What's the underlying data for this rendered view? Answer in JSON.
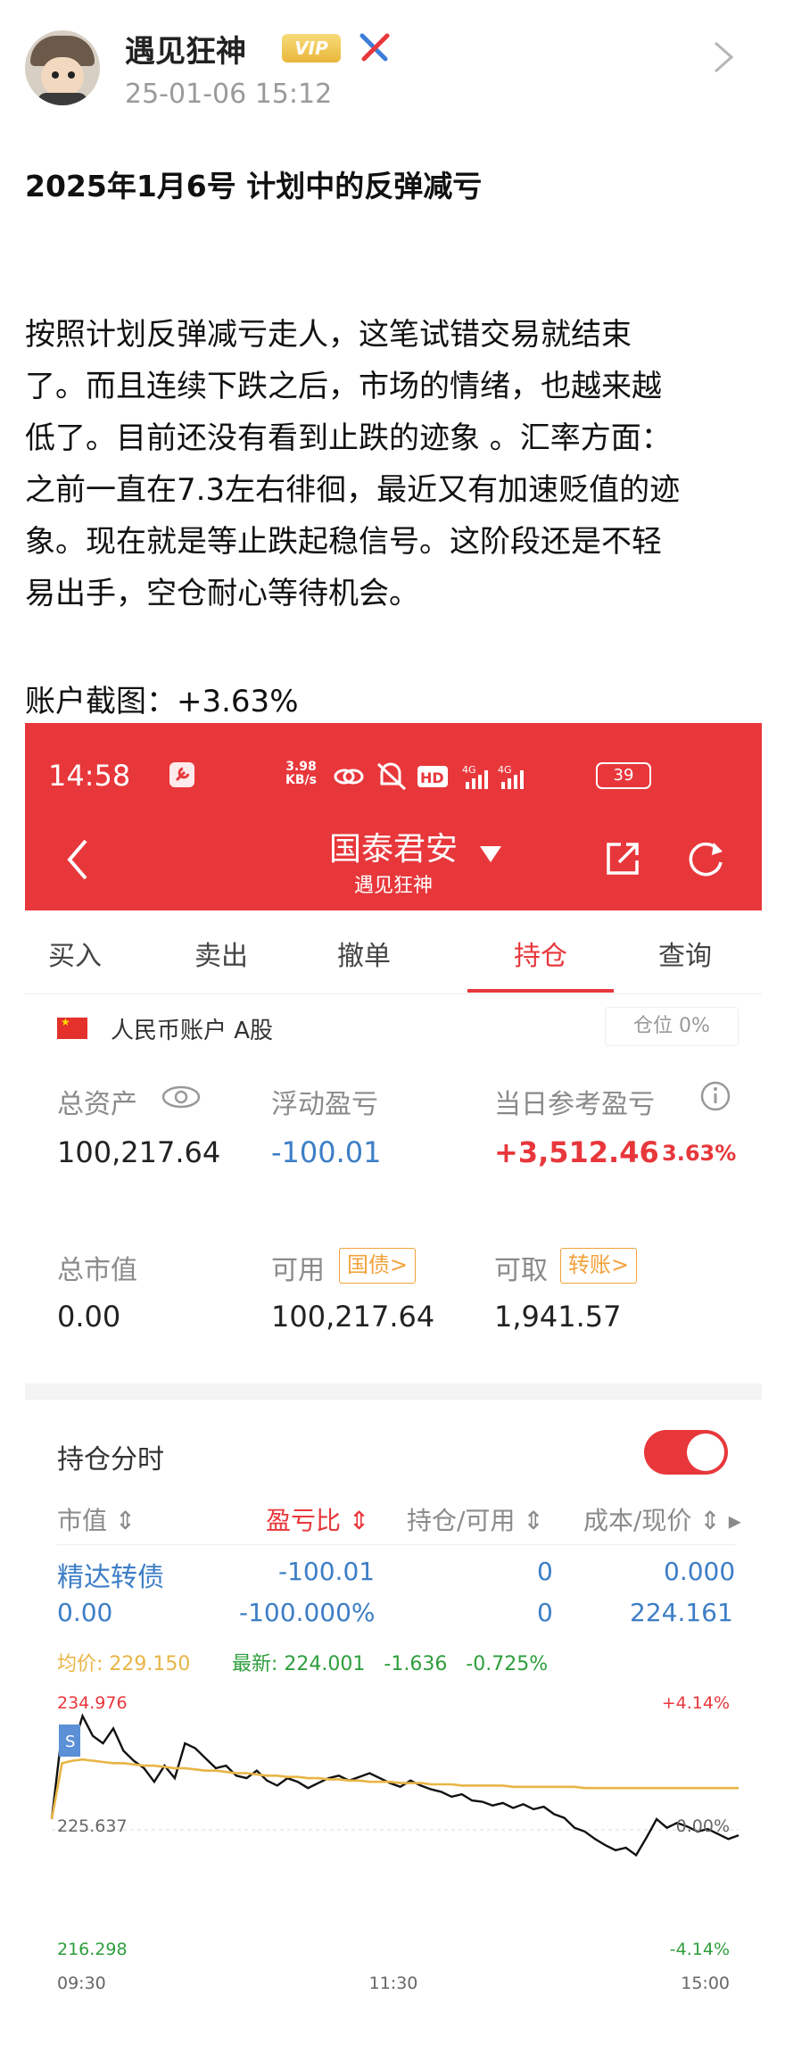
{
  "post": {
    "author": "遇见狂神",
    "vip_label": "VIP",
    "timestamp": "25-01-06 15:12",
    "title": "2025年1月6号 计划中的反弹减亏",
    "paragraph_lines": [
      "按照计划反弹减亏走人，这笔试错交易就结束",
      "了。而且连续下跌之后，市场的情绪，也越来越",
      "低了。目前还没有看到止跌的迹象 。汇率方面：",
      "之前一直在7.3左右徘徊，最近又有加速贬值的迹",
      "象。现在就是等止跌起稳信号。这阶段还是不轻",
      "易出手，空仓耐心等待机会。"
    ],
    "account_caption": "账户截图：+3.63%"
  },
  "app": {
    "status_time": "14:58",
    "net_speed_value": "3.98",
    "net_speed_unit": "KB/s",
    "battery": "39",
    "broker": "国泰君安",
    "user": "遇见狂神",
    "tabs": [
      "买入",
      "卖出",
      "撤单",
      "持仓",
      "查询"
    ],
    "active_tab": "持仓",
    "account_type": "人民币账户 A股",
    "position": "仓位 0%",
    "metrics": {
      "total_assets_label": "总资产",
      "total_assets": "100,217.64",
      "floating_pnl_label": "浮动盈亏",
      "floating_pnl": "-100.01",
      "daily_pnl_label": "当日参考盈亏",
      "daily_pnl": "+3,512.46",
      "daily_pnl_pct": "3.63%",
      "market_value_label": "总市值",
      "market_value": "0.00",
      "available_label": "可用",
      "available_tag": "国债>",
      "available": "100,217.64",
      "withdrawable_label": "可取",
      "withdrawable_tag": "转账>",
      "withdrawable": "1,941.57"
    },
    "holdings_title": "持仓分时",
    "toggle_on": true,
    "columns": [
      "市值",
      "盈亏比",
      "持仓/可用",
      "成本/现价"
    ],
    "holding": {
      "name": "精达转债",
      "pnl": "-100.01",
      "qty": "0",
      "cost": "0.000",
      "market_value": "0.00",
      "pnl_ratio": "-100.000%",
      "available": "0",
      "price": "224.161"
    },
    "chart_info": {
      "avg_label": "均价:",
      "avg_value": "229.150",
      "latest_label": "最新:",
      "latest_value": "224.001",
      "change": "-1.636",
      "change_pct": "-0.725%"
    }
  },
  "chart_data": {
    "type": "line",
    "y_high_label": "234.976",
    "y_mid_label": "225.637",
    "y_low_label": "216.298",
    "pct_high_label": "+4.14%",
    "pct_mid_label": "0.00%",
    "pct_low_label": "-4.14%",
    "time_start": "09:30",
    "time_mid": "11:30",
    "time_end": "15:00",
    "ylim": [
      216.298,
      234.976
    ],
    "series": [
      {
        "values": [
          226.5,
          233.5,
          232.0,
          234.8,
          233.2,
          232.6,
          233.8,
          232.0,
          231.2,
          230.6,
          229.5,
          230.8,
          229.8,
          232.6,
          232.2,
          231.4,
          230.6,
          230.8,
          230.0,
          229.8,
          230.4,
          229.6,
          229.2,
          229.8,
          229.5,
          229.0,
          229.4,
          229.8,
          230.0,
          229.6,
          229.9,
          230.2,
          229.8,
          229.4,
          229.1,
          229.6,
          229.2,
          228.9,
          228.7,
          228.3,
          228.5,
          228.0,
          227.9,
          227.6,
          227.8,
          227.4,
          227.7,
          227.3,
          227.5,
          226.9,
          226.6,
          225.8,
          225.5,
          224.9,
          224.4,
          224.0,
          224.2,
          223.6,
          225.0,
          226.5,
          225.8,
          226.2,
          225.9,
          225.5,
          225.7,
          225.3,
          224.9,
          225.2
        ]
      },
      {
        "values": [
          226.5,
          231.0,
          231.2,
          231.3,
          231.2,
          231.1,
          231.0,
          231.0,
          230.9,
          230.8,
          230.8,
          230.7,
          230.6,
          230.6,
          230.5,
          230.4,
          230.4,
          230.3,
          230.2,
          230.2,
          230.1,
          230.0,
          230.0,
          229.9,
          229.9,
          229.8,
          229.8,
          229.7,
          229.7,
          229.6,
          229.6,
          229.5,
          229.5,
          229.5,
          229.4,
          229.4,
          229.4,
          229.3,
          229.3,
          229.3,
          229.2,
          229.2,
          229.2,
          229.2,
          229.2,
          229.1,
          229.1,
          229.1,
          229.1,
          229.1,
          229.1,
          229.1,
          229.0,
          229.0,
          229.0,
          229.0,
          229.0,
          229.0,
          229.0,
          229.0,
          229.0,
          229.0,
          229.0,
          229.0,
          229.0,
          229.0,
          229.0,
          229.0
        ]
      }
    ],
    "colors": {
      "price": "#111111",
      "average": "#e8b546",
      "up": "#e8373b",
      "down": "#2e9e3c",
      "accent": "#e8373b",
      "link": "#3d7ec6"
    }
  }
}
